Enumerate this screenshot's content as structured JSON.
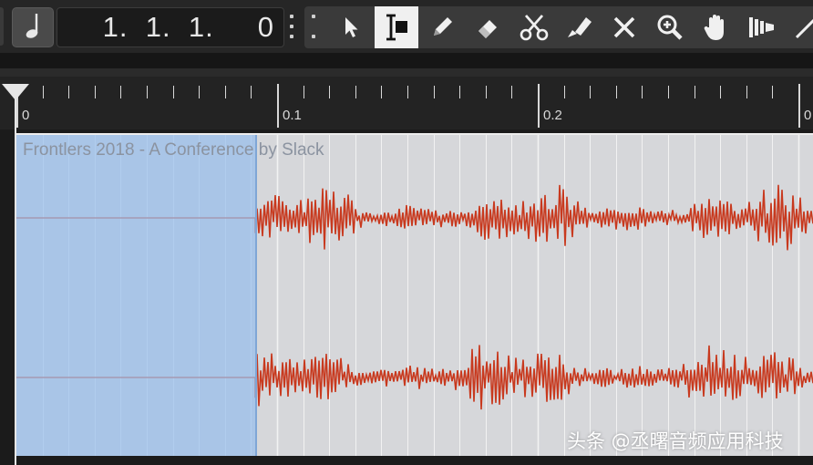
{
  "toolbar": {
    "note_value_icon": "quarter-note-icon",
    "position_display": "1.  1.  1.     0",
    "tools": [
      {
        "name": "object-selection-tool",
        "icon": "arrow-pointer-icon",
        "active": false
      },
      {
        "name": "range-selection-tool",
        "icon": "range-select-icon",
        "active": true
      },
      {
        "name": "draw-tool",
        "icon": "pencil-icon",
        "active": false
      },
      {
        "name": "erase-tool",
        "icon": "eraser-icon",
        "active": false
      },
      {
        "name": "split-tool",
        "icon": "scissors-icon",
        "active": false
      },
      {
        "name": "glue-tool",
        "icon": "glue-tube-icon",
        "active": false
      },
      {
        "name": "mute-tool",
        "icon": "x-mute-icon",
        "active": false
      },
      {
        "name": "zoom-tool",
        "icon": "magnifier-plus-icon",
        "active": false
      },
      {
        "name": "hand-tool",
        "icon": "hand-icon",
        "active": false
      },
      {
        "name": "comp-tool",
        "icon": "comp-bars-icon",
        "active": false
      },
      {
        "name": "line-tool",
        "icon": "line-icon",
        "active": false
      }
    ]
  },
  "ruler": {
    "labels": [
      "0",
      "0.1",
      "0.2",
      "0"
    ]
  },
  "event": {
    "title": "Frontlers 2018 - A Conference by Slack",
    "selection_fraction": 0.3,
    "waveform_color": "#c8391e",
    "selection_color": "#97beec"
  },
  "watermark": "头条 @丞曙音频应用科技"
}
